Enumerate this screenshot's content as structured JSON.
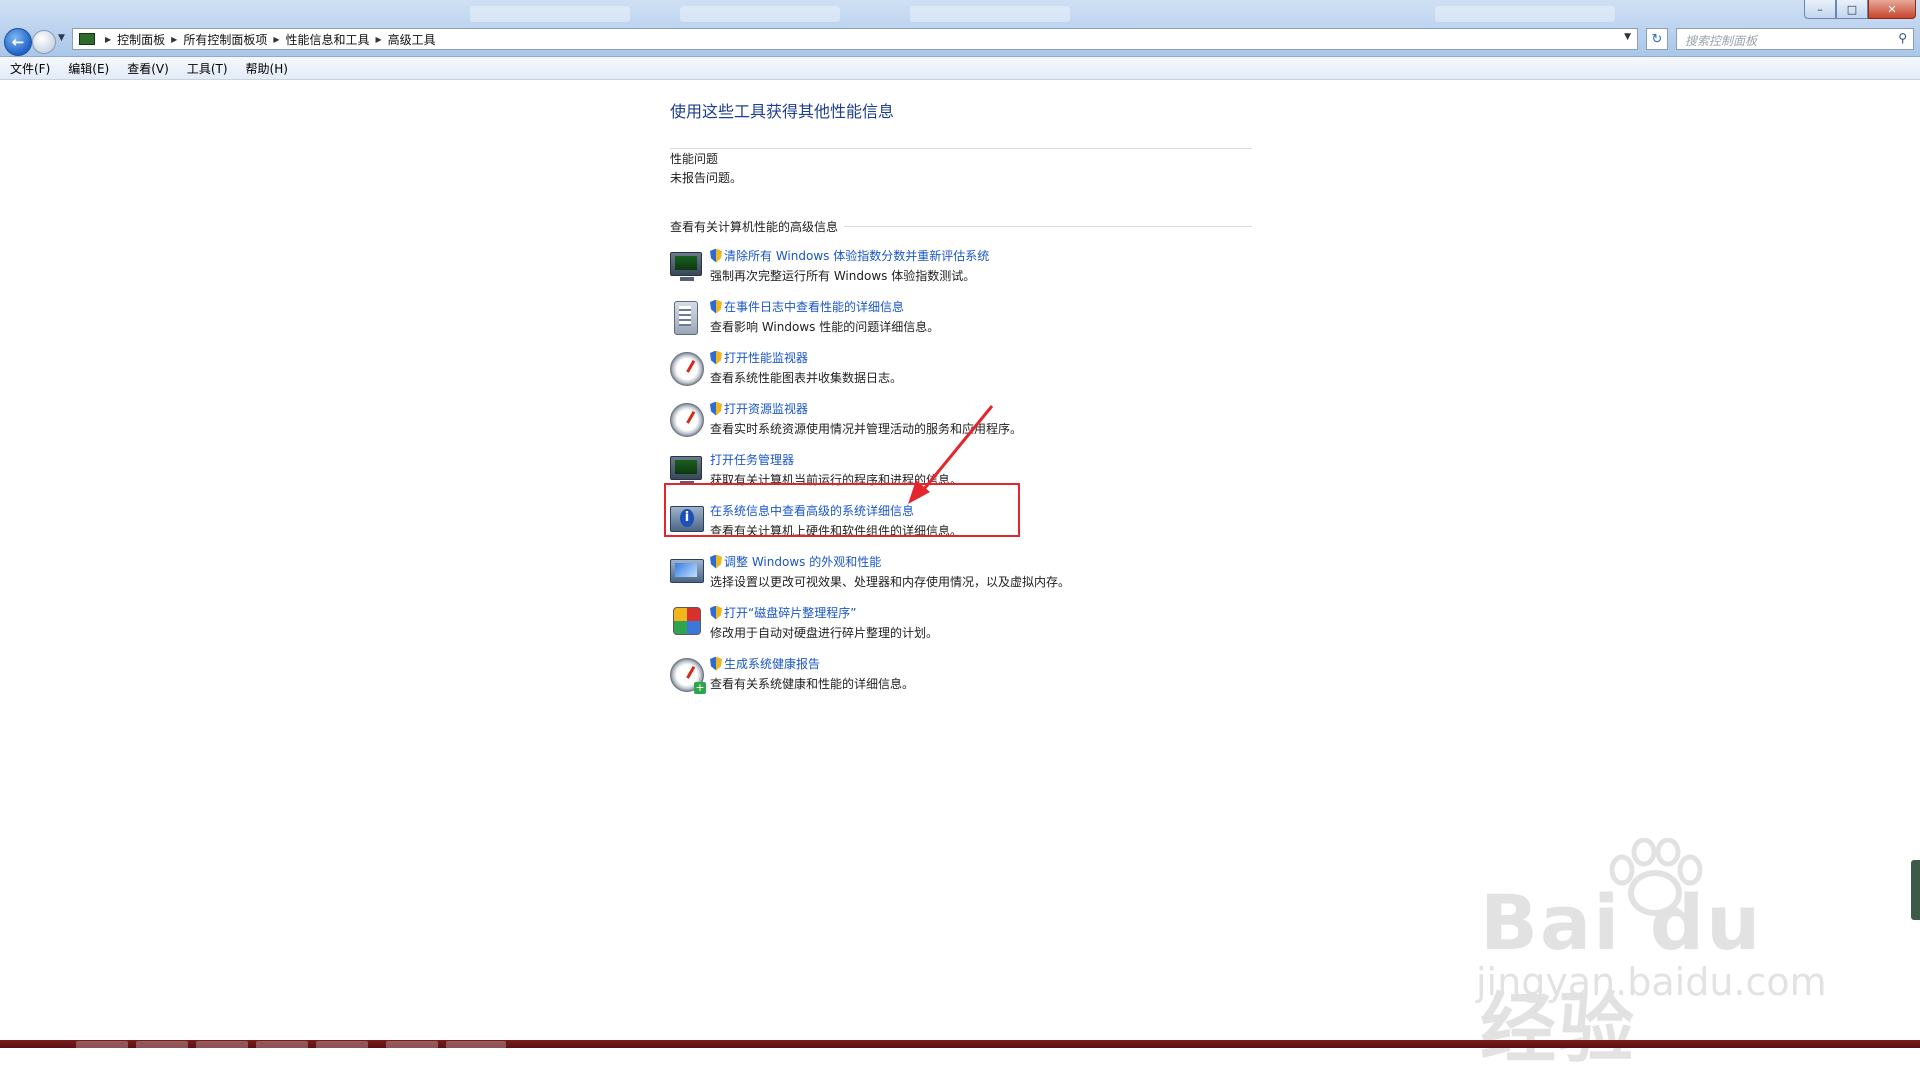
{
  "window": {
    "address_crumbs": [
      "控制面板",
      "所有控制面板项",
      "性能信息和工具",
      "高级工具"
    ],
    "search_placeholder": "搜索控制面板"
  },
  "menu": [
    "文件(F)",
    "编辑(E)",
    "查看(V)",
    "工具(T)",
    "帮助(H)"
  ],
  "page": {
    "heading": "使用这些工具获得其他性能信息",
    "perf_section_title": "性能问题",
    "perf_section_text": "未报告问题。",
    "advanced_section_title": "查看有关计算机性能的高级信息"
  },
  "tasks": [
    {
      "link": "清除所有 Windows 体验指数分数并重新评估系统",
      "desc": "强制再次完整运行所有 Windows 体验指数测试。",
      "icon": "monitor-icon",
      "shield": true
    },
    {
      "link": "在事件日志中查看性能的详细信息",
      "desc": "查看影响 Windows 性能的问题详细信息。",
      "icon": "event-log-icon",
      "shield": true
    },
    {
      "link": "打开性能监视器",
      "desc": "查看系统性能图表并收集数据日志。",
      "icon": "gauge-icon",
      "shield": true
    },
    {
      "link": "打开资源监视器",
      "desc": "查看实时系统资源使用情况并管理活动的服务和应用程序。",
      "icon": "gauge-icon",
      "shield": true
    },
    {
      "link": "打开任务管理器",
      "desc": "获取有关计算机当前运行的程序和进程的信息。",
      "icon": "monitor-icon",
      "shield": false
    },
    {
      "link": "在系统信息中查看高级的系统详细信息",
      "desc": "查看有关计算机上硬件和软件组件的详细信息。",
      "icon": "system-info-icon",
      "shield": false
    },
    {
      "link": "调整 Windows 的外观和性能",
      "desc": "选择设置以更改可视效果、处理器和内存使用情况，以及虚拟内存。",
      "icon": "visual-effects-icon",
      "shield": true
    },
    {
      "link": "打开“磁盘碎片整理程序”",
      "desc": "修改用于自动对硬盘进行碎片整理的计划。",
      "icon": "defrag-icon",
      "shield": true
    },
    {
      "link": "生成系统健康报告",
      "desc": "查看有关系统健康和性能的详细信息。",
      "icon": "health-report-icon",
      "shield": true
    }
  ],
  "watermark": {
    "brand": "Bai du 经验",
    "site": "jingyan.baidu.com"
  },
  "colors": {
    "link": "#1a56c8",
    "heading": "#1e3e8f",
    "annotation": "#e3262d"
  }
}
